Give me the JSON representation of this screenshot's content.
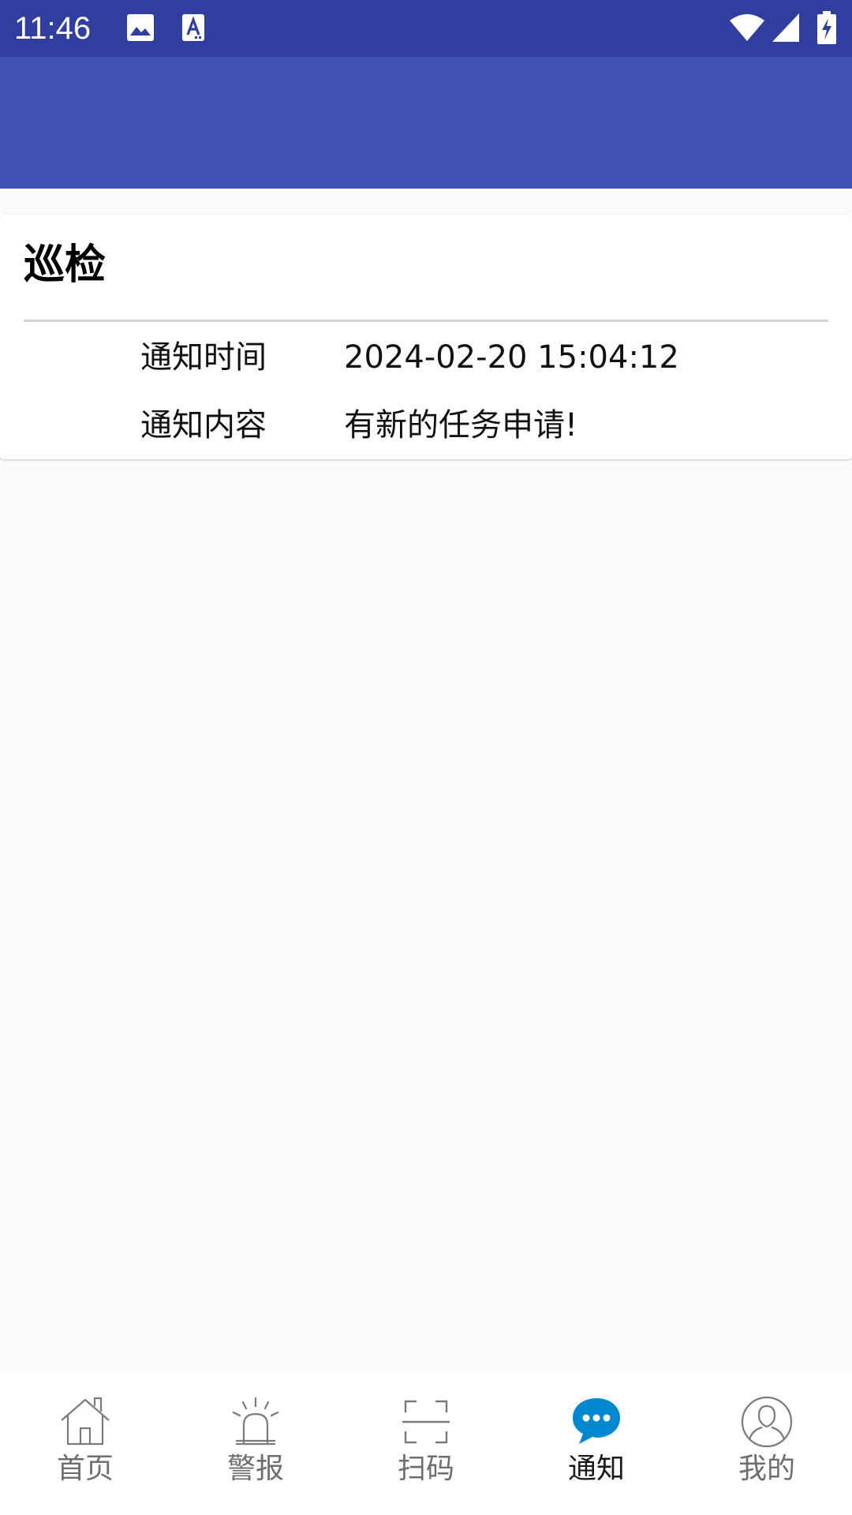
{
  "status_bar": {
    "time": "11:46",
    "icons": [
      "image-icon",
      "text-a-icon",
      "wifi-icon",
      "signal-icon",
      "battery-charging-icon"
    ]
  },
  "card": {
    "title": "巡检",
    "rows": [
      {
        "label": "通知时间",
        "value": "2024-02-20 15:04:12"
      },
      {
        "label": "通知内容",
        "value": "有新的任务申请!"
      }
    ]
  },
  "bottom_nav": {
    "items": [
      {
        "label": "首页",
        "icon": "home-icon",
        "active": false
      },
      {
        "label": "警报",
        "icon": "alarm-siren-icon",
        "active": false
      },
      {
        "label": "扫码",
        "icon": "scan-icon",
        "active": false
      },
      {
        "label": "通知",
        "icon": "chat-bubble-icon",
        "active": true
      },
      {
        "label": "我的",
        "icon": "user-icon",
        "active": false
      }
    ]
  },
  "colors": {
    "status_bar": "#303f9f",
    "app_bar": "#3f51b5",
    "accent": "#0288d1",
    "background": "#fafafa"
  }
}
